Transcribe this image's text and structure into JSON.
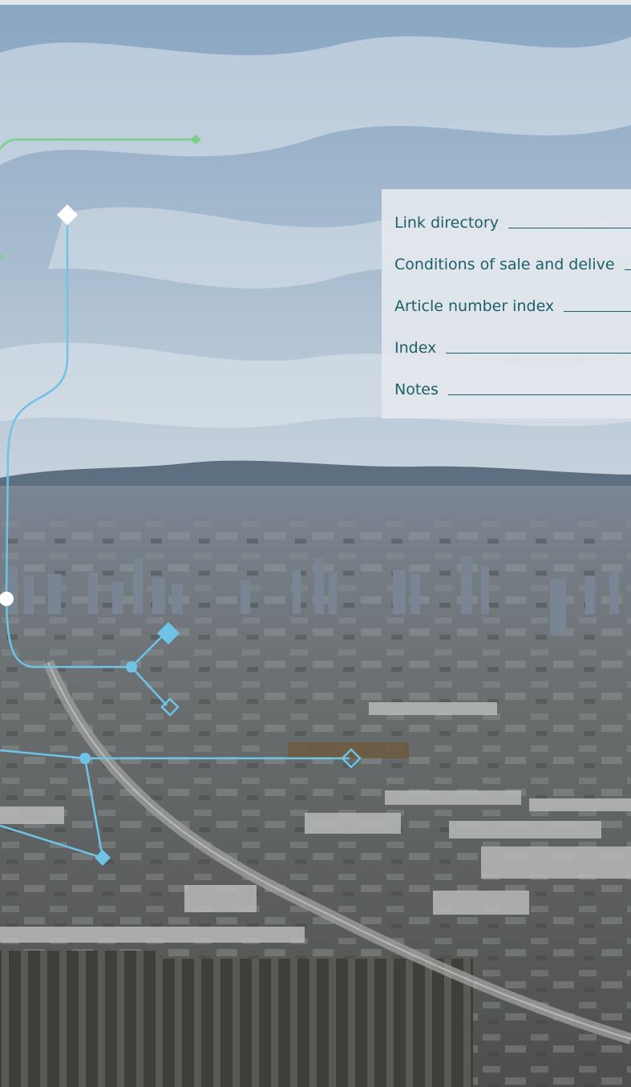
{
  "toc": {
    "items": [
      {
        "label": "Link directory"
      },
      {
        "label": "Conditions of sale and delive"
      },
      {
        "label": "Article number index"
      },
      {
        "label": "Index"
      },
      {
        "label": "Notes"
      }
    ]
  },
  "colors": {
    "accent_line": "#6ec3e6",
    "green_line": "#7ccf8a",
    "text": "#1d5f66",
    "panel": "#e2e7ed"
  }
}
